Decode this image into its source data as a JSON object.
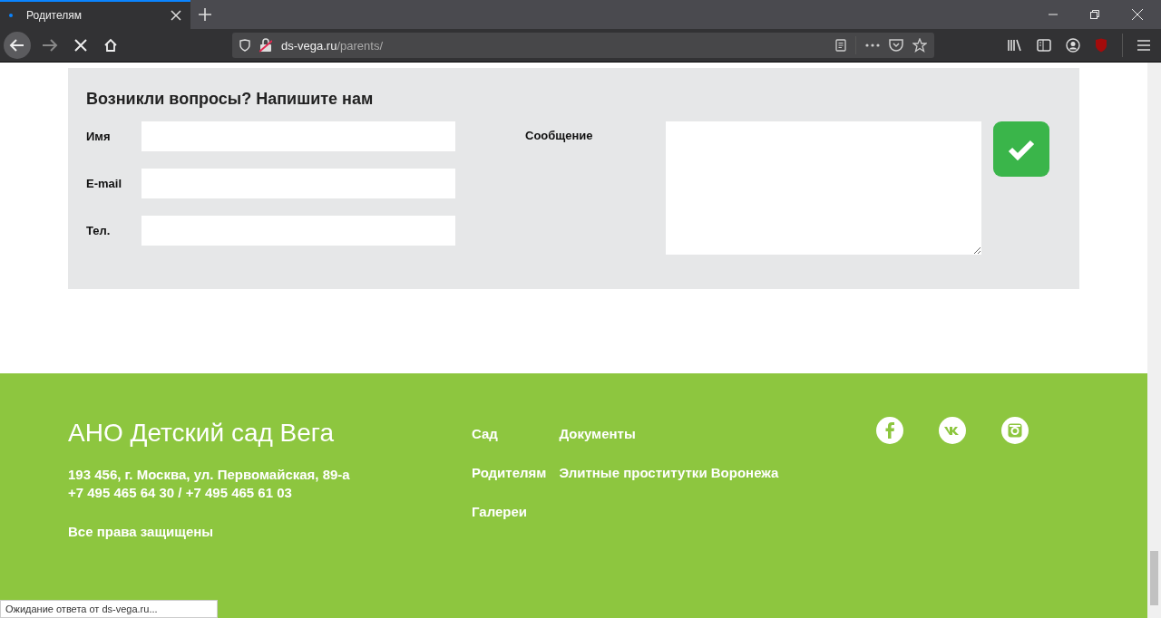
{
  "browser": {
    "tab": {
      "title": "Родителям"
    },
    "url": {
      "host": "ds-vega.ru",
      "path": "/parents/"
    },
    "status": "Ожидание ответа от ds-vega.ru..."
  },
  "contact_form": {
    "title": "Возникли вопросы? Напишите нам",
    "fields": [
      {
        "label": "Имя"
      },
      {
        "label": "E-mail"
      },
      {
        "label": "Тел."
      }
    ],
    "message_label": "Сообщение"
  },
  "footer": {
    "title": "АНО Детский сад Вега",
    "address": "193 456, г. Москва, ул. Первомайская, 89-а",
    "phones": "+7 495 465 64 30 / +7 495 465 61 03",
    "rights": "Все права защищены",
    "nav": [
      "Сад",
      "Документы",
      "Родителям",
      "Элитные проститутки Воронежа",
      "Галереи"
    ]
  }
}
